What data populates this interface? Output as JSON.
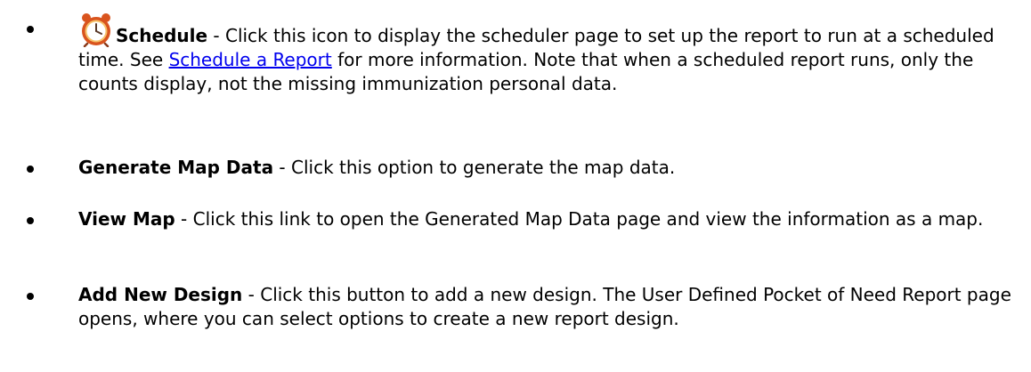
{
  "items": [
    {
      "term": "Schedule",
      "icon": "alarm-clock-icon",
      "text_before_link": " - Click this icon to display the scheduler page to set up the report to run at a scheduled time. See ",
      "link_text": "Schedule a Report",
      "text_after_link": " for more information. Note that when a scheduled report runs, only the counts display, not the missing immunization personal data."
    },
    {
      "term": "Generate Map Data",
      "text": " - Click this option to generate the map data."
    },
    {
      "term": "View Map",
      "text": " - Click this link to open the Generated Map Data page and view the information as a map."
    },
    {
      "term": "Add New Design",
      "text": " - Click this button to add a new design. The User Defined Pocket of Need Report page opens, where you can select options to create a new report design."
    }
  ],
  "colors": {
    "link": "#0000ee",
    "text": "#000000",
    "clock_body": "#f0a030",
    "clock_rim": "#d9541e"
  }
}
